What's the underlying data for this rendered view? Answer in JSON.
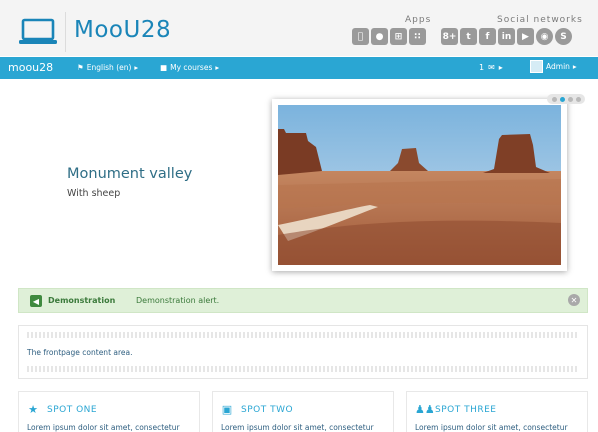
{
  "header": {
    "site_name": "MooU28",
    "apps_label": "Apps",
    "social_label": "Social networks",
    "app_icons": [
      "apple-icon",
      "android-icon",
      "windows-icon",
      "blackberry-icon"
    ],
    "social_icons": [
      {
        "name": "googleplus-icon",
        "glyph": "8+"
      },
      {
        "name": "twitter-icon",
        "glyph": "t"
      },
      {
        "name": "facebook-icon",
        "glyph": "f"
      },
      {
        "name": "linkedin-icon",
        "glyph": "in"
      },
      {
        "name": "youtube-icon",
        "glyph": "▶"
      },
      {
        "name": "flickr-icon",
        "glyph": "◉"
      },
      {
        "name": "skype-icon",
        "glyph": "S"
      }
    ]
  },
  "nav": {
    "brand": "moou28",
    "language": "English (en)",
    "courses": "My courses",
    "messages_count": "1",
    "admin": "Admin"
  },
  "slider": {
    "title": "Monument valley",
    "caption": "With sheep",
    "dot_count": 4,
    "active_dot": 1
  },
  "alert": {
    "title": "Demonstration",
    "text": "Demonstration alert."
  },
  "content": {
    "text": "The frontpage content area."
  },
  "spots": [
    {
      "title": "SPOT ONE",
      "icon": "star-icon",
      "text": "Lorem ipsum dolor sit amet, consectetur"
    },
    {
      "title": "SPOT TWO",
      "icon": "bus-icon",
      "text": "Lorem ipsum dolor sit amet, consectetur"
    },
    {
      "title": "SPOT THREE",
      "icon": "users-icon",
      "text": "Lorem ipsum dolor sit amet, consectetur"
    }
  ],
  "colors": {
    "accent": "#2aa6d3",
    "brand": "#1a85b8",
    "alert_bg": "#dff0d8",
    "header_bg": "#f4f4f4"
  }
}
